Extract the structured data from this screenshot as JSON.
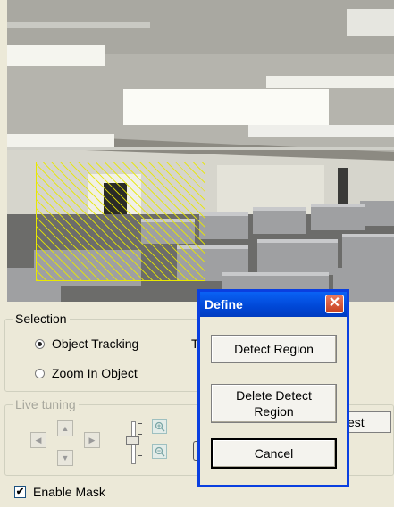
{
  "selection": {
    "group_label": "Selection",
    "options": [
      {
        "label": "Object Tracking",
        "selected": true
      },
      {
        "label": "Zoom In Object",
        "selected": false
      }
    ],
    "partial_label": "T"
  },
  "live_tuning": {
    "group_label": "Live tuning",
    "test_button_partial": "est"
  },
  "enable_mask": {
    "label": "Enable Mask",
    "checked": true
  },
  "dialog": {
    "title": "Define",
    "buttons": [
      "Detect Region",
      "Delete Detect Region",
      "Cancel"
    ]
  },
  "icons": {
    "up": "up-arrow-icon",
    "down": "down-arrow-icon",
    "left": "left-arrow-icon",
    "right": "right-arrow-icon",
    "zoom_in": "zoom-in-icon",
    "zoom_out": "zoom-out-icon",
    "close": "close-icon"
  },
  "colors": {
    "titlebar": "#0054e3",
    "mask_hatch": "#e8e800",
    "close_button": "#d9532f"
  }
}
